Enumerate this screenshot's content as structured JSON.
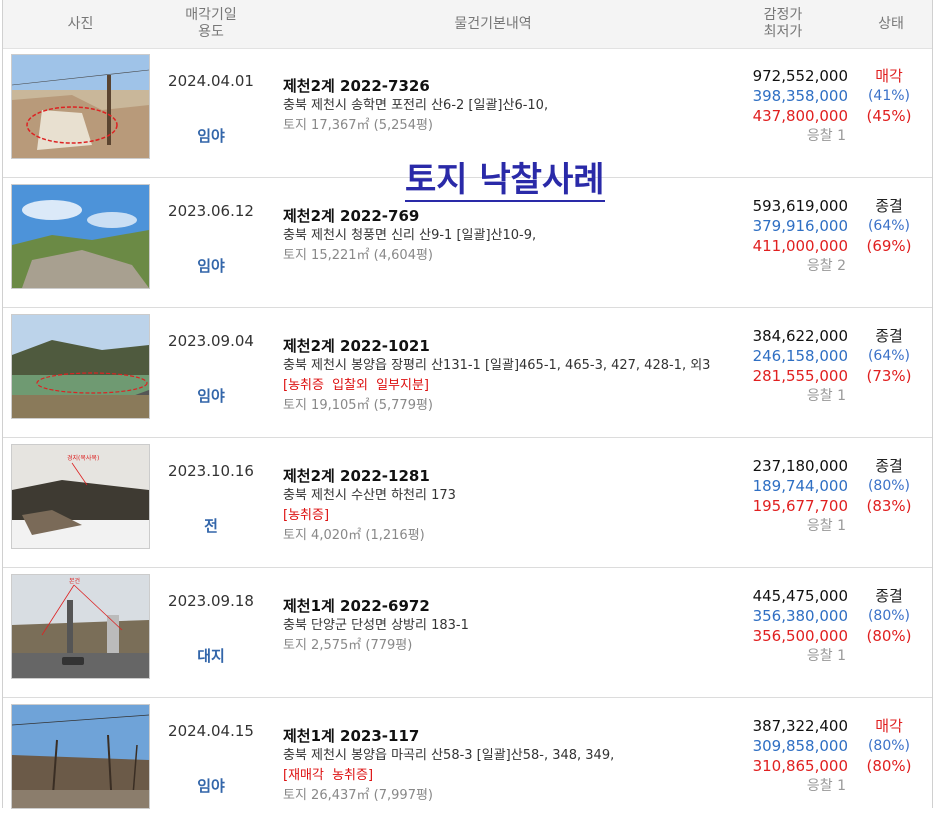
{
  "header": {
    "photo": "사진",
    "date_use": "매각기일\n용도",
    "details": "물건기본내역",
    "appraisal": "감정가\n최저가",
    "status": "상태"
  },
  "overlay_title": "토지 낙찰사례",
  "rows": [
    {
      "date": "2024.04.01",
      "use": "임야",
      "case": "제천2계 2022-7326",
      "addr": "충북 제천시 송학면 포전리 산6-2  [일괄]산6-10,",
      "notes": "",
      "land": "토지 17,367㎡ (5,254평)",
      "appraisal": "972,552,000",
      "minimum": "398,358,000",
      "sold": "437,800,000",
      "bids": "응찰 1",
      "status": "매각",
      "min_pct": "(41%)",
      "sold_pct": "(45%)"
    },
    {
      "date": "2023.06.12",
      "use": "임야",
      "case": "제천2계 2022-769",
      "addr": "충북 제천시 청풍면 신리 산9-1  [일괄]산10-9,",
      "notes": "",
      "land": "토지 15,221㎡ (4,604평)",
      "appraisal": "593,619,000",
      "minimum": "379,916,000",
      "sold": "411,000,000",
      "bids": "응찰 2",
      "status": "종결",
      "min_pct": "(64%)",
      "sold_pct": "(69%)"
    },
    {
      "date": "2023.09.04",
      "use": "임야",
      "case": "제천2계 2022-1021",
      "addr": "충북 제천시 봉양읍 장평리 산131-1  [일괄]465-1, 465-3, 427, 428-1, 외3",
      "notes": "[농취증   입찰외   일부지분]",
      "land": "토지 19,105㎡ (5,779평)",
      "appraisal": "384,622,000",
      "minimum": "246,158,000",
      "sold": "281,555,000",
      "bids": "응찰 1",
      "status": "종결",
      "min_pct": "(64%)",
      "sold_pct": "(73%)"
    },
    {
      "date": "2023.10.16",
      "use": "전",
      "case": "제천2계 2022-1281",
      "addr": "충북 제천시 수산면 하천리 173",
      "notes": "[농취증]",
      "land": "토지 4,020㎡ (1,216평)",
      "appraisal": "237,180,000",
      "minimum": "189,744,000",
      "sold": "195,677,700",
      "bids": "응찰 1",
      "status": "종결",
      "min_pct": "(80%)",
      "sold_pct": "(83%)"
    },
    {
      "date": "2023.09.18",
      "use": "대지",
      "case": "제천1계 2022-6972",
      "addr": "충북 단양군 단성면 상방리 183-1",
      "notes": "",
      "land": "토지 2,575㎡ (779평)",
      "appraisal": "445,475,000",
      "minimum": "356,380,000",
      "sold": "356,500,000",
      "bids": "응찰 1",
      "status": "종결",
      "min_pct": "(80%)",
      "sold_pct": "(80%)"
    },
    {
      "date": "2024.04.15",
      "use": "임야",
      "case": "제천1계 2023-117",
      "addr": "충북 제천시 봉양읍 마곡리 산58-3  [일괄]산58-, 348, 349,",
      "notes": "[재매각   농취증]",
      "land": "토지 26,437㎡ (7,997평)",
      "appraisal": "387,322,400",
      "minimum": "309,858,000",
      "sold": "310,865,000",
      "bids": "응찰 1",
      "status": "매각",
      "min_pct": "(80%)",
      "sold_pct": "(80%)"
    }
  ],
  "photo_labels": {
    "row4": "경지(복사목)",
    "row5": "본건"
  },
  "colors": {
    "accent_blue": "#2f6fc3",
    "sold_red": "#e02020",
    "overlay": "#2a2aa8"
  }
}
